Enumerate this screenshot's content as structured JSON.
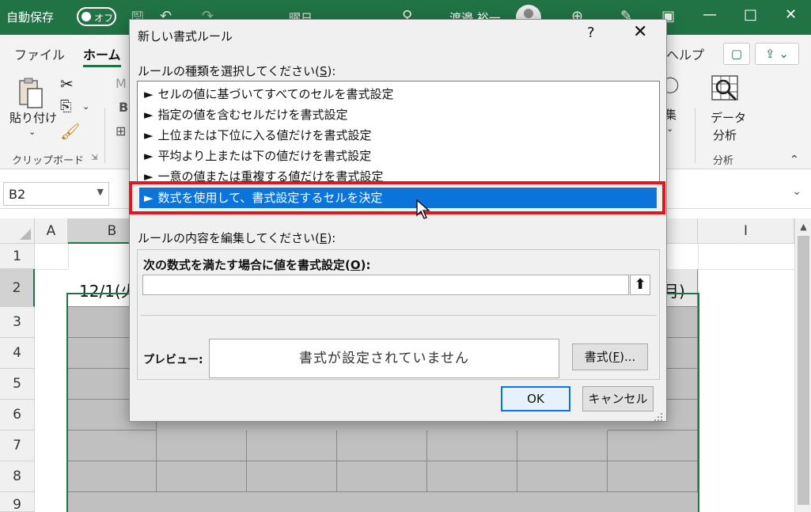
{
  "titlebar": {
    "autosave_label": "自動保存",
    "autosave_toggle": "オフ",
    "title_partial": "曜日",
    "user_partial": "渡邉 裕一"
  },
  "ribbon": {
    "tabs": [
      "ファイル",
      "ホーム",
      "ヘルプ"
    ],
    "paste_label": "貼り付け",
    "clipboard_group": "クリップボード",
    "collect_label": "集",
    "data_analysis_label": "データ\n分析",
    "data_analysis_line1": "データ",
    "data_analysis_line2": "分析",
    "analysis_group": "分析",
    "font_partial_b": "B",
    "font_partial_m": "M"
  },
  "formula_bar": {
    "name_box": "B2"
  },
  "sheet": {
    "columns": [
      "A",
      "B",
      "I"
    ],
    "rows": [
      "1",
      "2",
      "3",
      "4",
      "5",
      "6",
      "7",
      "8",
      "9"
    ],
    "b2_partial": "12/1(火",
    "right_partial": "月)"
  },
  "dialog": {
    "title": "新しい書式ルール",
    "help": "?",
    "close": "✕",
    "select_type_label": "ルールの種類を選択してください(",
    "select_type_key": "S",
    "select_type_suffix": "):",
    "rule_types": [
      "セルの値に基づいてすべてのセルを書式設定",
      "指定の値を含むセルだけを書式設定",
      "上位または下位に入る値だけを書式設定",
      "平均より上または下の値だけを書式設定",
      "一意の値または重複する値だけを書式設定",
      "数式を使用して、書式設定するセルを決定"
    ],
    "selected_index": 5,
    "edit_label": "ルールの内容を編集してください(",
    "edit_key": "E",
    "edit_suffix": "):",
    "formula_label": "次の数式を満たす場合に値を書式設定(",
    "formula_key": "O",
    "formula_suffix": "):",
    "formula_value": "",
    "preview_label": "プレビュー:",
    "preview_text": "書式が設定されていません",
    "format_button": "書式(",
    "format_key": "F",
    "format_suffix": ")...",
    "ok": "OK",
    "cancel": "キャンセル"
  },
  "colors": {
    "excel_green": "#217346",
    "selection_blue": "#0a74da",
    "highlight_red": "#e8141c",
    "cell_gray": "#c0c0c0"
  }
}
